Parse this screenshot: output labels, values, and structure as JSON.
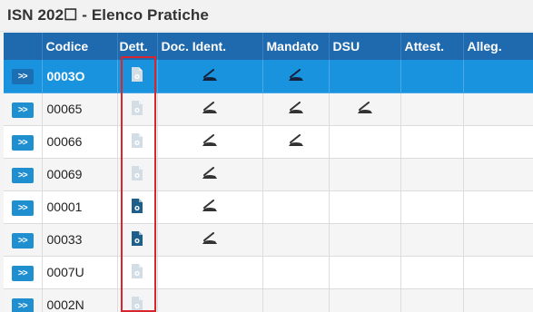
{
  "title": "ISN 202☐ - Elenco Pratiche",
  "columns": [
    "",
    "Codice",
    "Dett.",
    "Doc. Ident.",
    "Mandato",
    "DSU",
    "Attest.",
    "Alleg."
  ],
  "nav_label": ">>",
  "rows": [
    {
      "code": "0003O",
      "selected": true,
      "dett": "faded",
      "doc_ident": true,
      "mandato": true,
      "dsu": false
    },
    {
      "code": "00065",
      "selected": false,
      "dett": "faded",
      "doc_ident": true,
      "mandato": true,
      "dsu": true
    },
    {
      "code": "00066",
      "selected": false,
      "dett": "faded",
      "doc_ident": true,
      "mandato": true,
      "dsu": false
    },
    {
      "code": "00069",
      "selected": false,
      "dett": "faded",
      "doc_ident": true,
      "mandato": false,
      "dsu": false
    },
    {
      "code": "00001",
      "selected": false,
      "dett": "solid",
      "doc_ident": true,
      "mandato": false,
      "dsu": false
    },
    {
      "code": "00033",
      "selected": false,
      "dett": "solid",
      "doc_ident": true,
      "mandato": false,
      "dsu": false
    },
    {
      "code": "0007U",
      "selected": false,
      "dett": "faded",
      "doc_ident": false,
      "mandato": false,
      "dsu": false
    },
    {
      "code": "0002N",
      "selected": false,
      "dett": "faded",
      "doc_ident": false,
      "mandato": false,
      "dsu": false
    }
  ],
  "colors": {
    "header": "#1f69ae",
    "selected_row": "#1a93de",
    "nav_button": "#1f8fd0",
    "doc_solid": "#1d5f8a",
    "doc_faded": "#d3dde6",
    "highlight": "#d9262e"
  },
  "icons": {
    "nav": "double-chevron-right-icon",
    "dett": "document-detail-icon",
    "signed": "signature-icon"
  }
}
